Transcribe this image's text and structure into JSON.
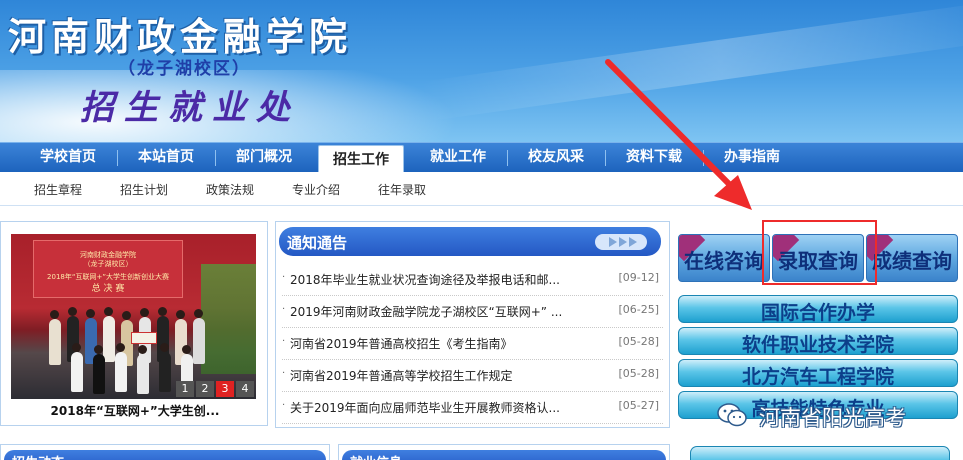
{
  "header": {
    "school_name": "河南财政金融学院",
    "campus": "（龙子湖校区）",
    "office": "招生就业处"
  },
  "main_nav": {
    "items": [
      {
        "label": "学校首页"
      },
      {
        "label": "本站首页"
      },
      {
        "label": "部门概况"
      },
      {
        "label": "招生工作",
        "active": true
      },
      {
        "label": "就业工作"
      },
      {
        "label": "校友风采"
      },
      {
        "label": "资料下载"
      },
      {
        "label": "办事指南"
      }
    ]
  },
  "sub_nav": {
    "items": [
      {
        "label": "招生章程"
      },
      {
        "label": "招生计划"
      },
      {
        "label": "政策法规"
      },
      {
        "label": "专业介绍"
      },
      {
        "label": "往年录取"
      }
    ]
  },
  "slideshow": {
    "caption": "2018年“互联网+”大学生创...",
    "pages": [
      "1",
      "2",
      "3",
      "4"
    ],
    "active_page": "3"
  },
  "notices": {
    "title": "通知通告",
    "items": [
      {
        "text": "2018年毕业生就业状况查询途径及举报电话和邮...",
        "date": "[09-12]"
      },
      {
        "text": "2019年河南财政金融学院龙子湖校区“互联网+” ...",
        "date": "[06-25]"
      },
      {
        "text": "河南省2019年普通高校招生《考生指南》",
        "date": "[05-28]"
      },
      {
        "text": "河南省2019年普通高等学校招生工作规定",
        "date": "[05-28]"
      },
      {
        "text": "关于2019年面向应届师范毕业生开展教师资格认...",
        "date": "[05-27]"
      }
    ]
  },
  "quick_links": {
    "online": "在线咨询",
    "admission": "录取查询",
    "score": "成绩查询"
  },
  "college_links": [
    {
      "label": "国际合作办学"
    },
    {
      "label": "软件职业技术学院"
    },
    {
      "label": "北方汽车工程学院"
    },
    {
      "label": "高技能特色专业"
    }
  ],
  "watermark": "河南省阳光高考",
  "bottom_boxes": {
    "left_title": "招生动态",
    "middle_title": "就业信息"
  },
  "colors": {
    "nav_blue": "#1d63bd",
    "highlight_red": "#ee2b2b"
  }
}
